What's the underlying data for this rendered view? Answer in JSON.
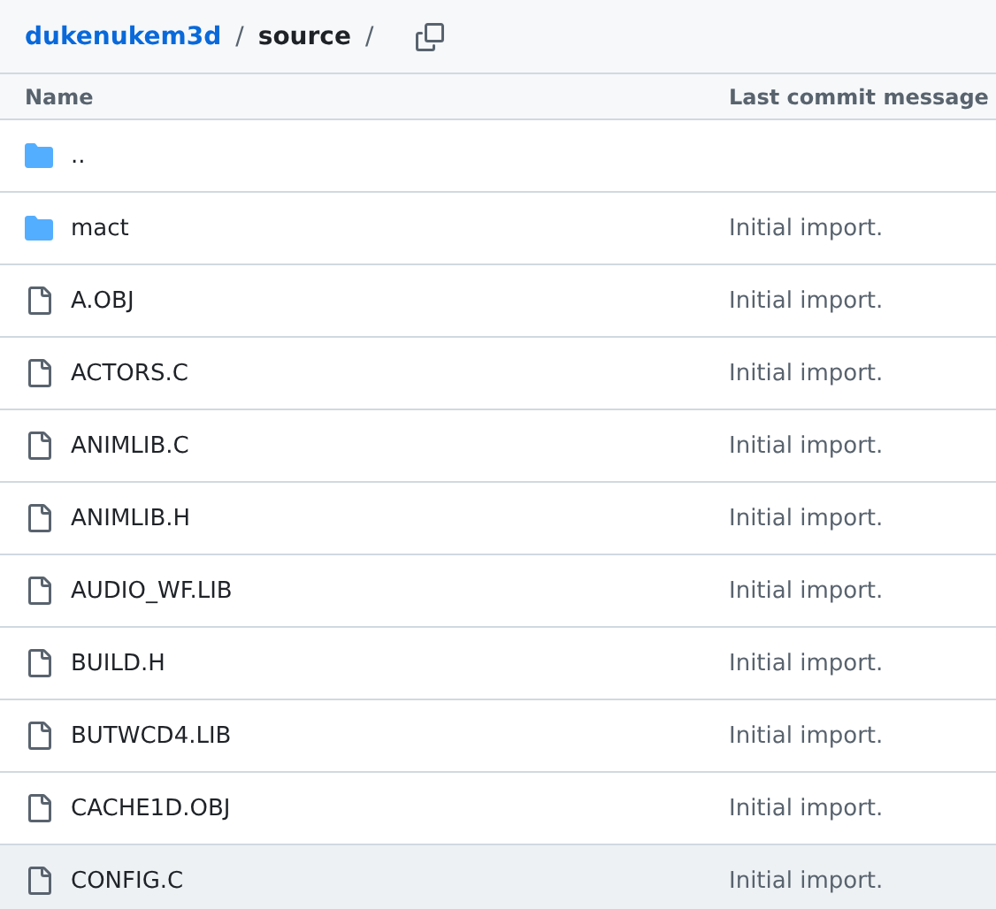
{
  "breadcrumb": {
    "repo": "dukenukem3d",
    "separator_1": "/",
    "folder": "source",
    "separator_2": "/"
  },
  "table": {
    "columns": [
      "Name",
      "Last commit message"
    ],
    "rows": [
      {
        "kind": "folder",
        "name": "..",
        "hovered": false
      },
      {
        "kind": "folder",
        "name": "mact",
        "message": "Initial import.",
        "hovered": false
      },
      {
        "kind": "file",
        "name": "A.OBJ",
        "message": "Initial import.",
        "hovered": false
      },
      {
        "kind": "file",
        "name": "ACTORS.C",
        "message": "Initial import.",
        "hovered": false
      },
      {
        "kind": "file",
        "name": "ANIMLIB.C",
        "message": "Initial import.",
        "hovered": false
      },
      {
        "kind": "file",
        "name": "ANIMLIB.H",
        "message": "Initial import.",
        "hovered": false
      },
      {
        "kind": "file",
        "name": "AUDIO_WF.LIB",
        "message": "Initial import.",
        "hovered": false
      },
      {
        "kind": "file",
        "name": "BUILD.H",
        "message": "Initial import.",
        "hovered": false
      },
      {
        "kind": "file",
        "name": "BUTWCD4.LIB",
        "message": "Initial import.",
        "hovered": false
      },
      {
        "kind": "file",
        "name": "CACHE1D.OBJ",
        "message": "Initial import.",
        "hovered": false
      },
      {
        "kind": "file",
        "name": "CONFIG.C",
        "message": "Initial import.",
        "hovered": true
      }
    ]
  }
}
